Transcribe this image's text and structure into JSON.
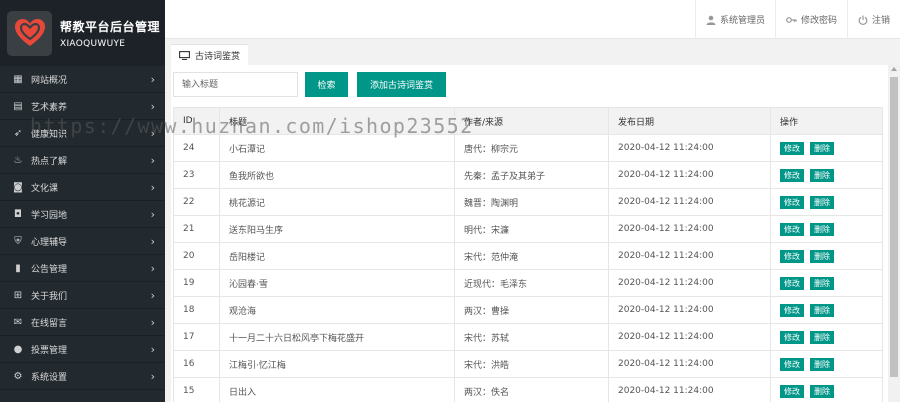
{
  "brand": {
    "title": "帮教平台后台管理",
    "subtitle": "XIAOQUWUYE"
  },
  "colors": {
    "accent": "#009688",
    "sidebar": "#222a30",
    "logo_red": "#e8483a"
  },
  "sidebar": {
    "items": [
      {
        "icon": "dashboard-icon",
        "label": "网站概况"
      },
      {
        "icon": "book-icon",
        "label": "艺术素养"
      },
      {
        "icon": "rocket-icon",
        "label": "健康知识"
      },
      {
        "icon": "fire-icon",
        "label": "热点了解"
      },
      {
        "icon": "bag-icon",
        "label": "文化课"
      },
      {
        "icon": "shopping-bag-icon",
        "label": "学习园地"
      },
      {
        "icon": "shield-icon",
        "label": "心理辅导"
      },
      {
        "icon": "bar-chart-icon",
        "label": "公告管理"
      },
      {
        "icon": "gift-icon",
        "label": "关于我们"
      },
      {
        "icon": "message-icon",
        "label": "在线留言"
      },
      {
        "icon": "alert-icon",
        "label": "投票管理"
      },
      {
        "icon": "gear-icon",
        "label": "系统设置"
      }
    ]
  },
  "header": {
    "admin": "系统管理员",
    "change_password": "修改密码",
    "logout": "注销"
  },
  "tab": {
    "label": "古诗词鉴赏"
  },
  "toolbar": {
    "search_placeholder": "输入标题",
    "search_label": "检索",
    "add_label": "添加古诗词鉴赏"
  },
  "table": {
    "columns": [
      "ID",
      "标题",
      "作者/来源",
      "发布日期",
      "操作"
    ],
    "rows": [
      {
        "id": "24",
        "title": "小石潭记",
        "author": "唐代：柳宗元",
        "date": "2020-04-12 11:24:00"
      },
      {
        "id": "23",
        "title": "鱼我所欲也",
        "author": "先秦：孟子及其弟子",
        "date": "2020-04-12 11:24:00"
      },
      {
        "id": "22",
        "title": "桃花源记",
        "author": "魏晋：陶渊明",
        "date": "2020-04-12 11:24:00"
      },
      {
        "id": "21",
        "title": "送东阳马生序",
        "author": "明代：宋濂",
        "date": "2020-04-12 11:24:00"
      },
      {
        "id": "20",
        "title": "岳阳楼记",
        "author": "宋代：范仲淹",
        "date": "2020-04-12 11:24:00"
      },
      {
        "id": "19",
        "title": "沁园春·雪",
        "author": "近现代：毛泽东",
        "date": "2020-04-12 11:24:00"
      },
      {
        "id": "18",
        "title": "观沧海",
        "author": "两汉：曹操",
        "date": "2020-04-12 11:24:00"
      },
      {
        "id": "17",
        "title": "十一月二十六日松风亭下梅花盛开",
        "author": "宋代：苏轼",
        "date": "2020-04-12 11:24:00"
      },
      {
        "id": "16",
        "title": "江梅引·忆江梅",
        "author": "宋代：洪皓",
        "date": "2020-04-12 11:24:00"
      },
      {
        "id": "15",
        "title": "日出入",
        "author": "两汉：佚名",
        "date": "2020-04-12 11:24:00"
      }
    ],
    "edit_label": "修改",
    "delete_label": "删除"
  },
  "watermark": "https://www.huzhan.com/ishop23552"
}
